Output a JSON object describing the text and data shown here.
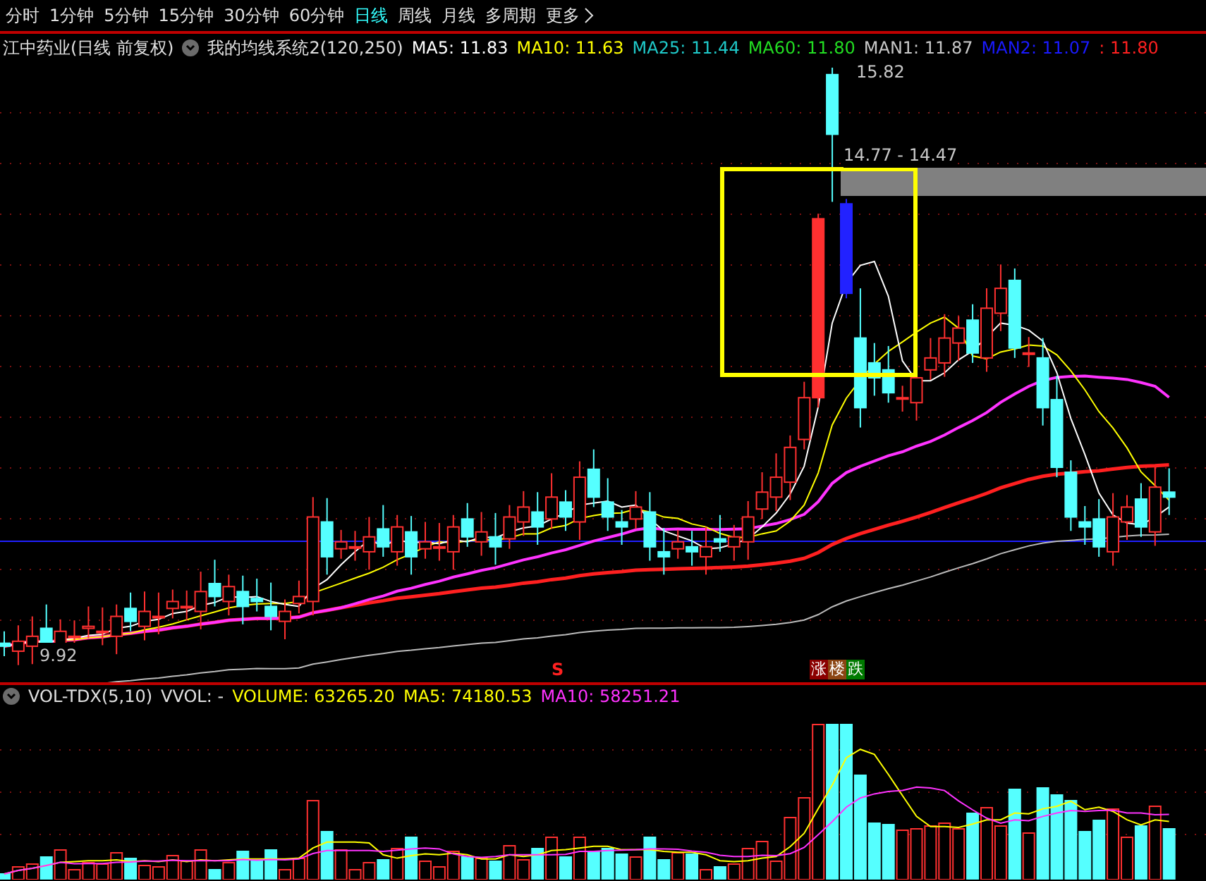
{
  "menu": [
    {
      "label": "分时",
      "selected": false
    },
    {
      "label": "1分钟",
      "selected": false
    },
    {
      "label": "5分钟",
      "selected": false
    },
    {
      "label": "15分钟",
      "selected": false
    },
    {
      "label": "30分钟",
      "selected": false
    },
    {
      "label": "60分钟",
      "selected": false
    },
    {
      "label": "日线",
      "selected": true
    },
    {
      "label": "周线",
      "selected": false
    },
    {
      "label": "月线",
      "selected": false
    },
    {
      "label": "多周期",
      "selected": false
    },
    {
      "label": "更多",
      "selected": false
    }
  ],
  "info_bar": {
    "title": "江中药业(日线 前复权)",
    "indicator": "我的均线系统2(120,250)",
    "values": [
      {
        "text": "MA5: 11.83",
        "color": "#ffffff"
      },
      {
        "text": "MA10: 11.63",
        "color": "#ffff00"
      },
      {
        "text": "MA25: 11.44",
        "color": "#1fc8c8"
      },
      {
        "text": "MA60: 11.80",
        "color": "#22dd22"
      },
      {
        "text": "MAN1: 11.87",
        "color": "#c8c8c8"
      },
      {
        "text": "MAN2: 11.07",
        "color": "#1a1aff"
      },
      {
        "text": ": 11.80",
        "color": "#ff2020"
      }
    ]
  },
  "price_chart": {
    "high_label": "15.82",
    "range_label": "14.77 - 14.47",
    "low_label": "9.92",
    "signal_mark": "S",
    "badge": [
      {
        "text": "涨",
        "color": "#8b0000"
      },
      {
        "text": "楼",
        "color": "#8b4513"
      },
      {
        "text": "跌",
        "color": "#007a00"
      }
    ]
  },
  "volume_panel": {
    "title": "VOL-TDX(5,10)",
    "values": [
      {
        "text": "VVOL: -",
        "color": "#e0e0e0"
      },
      {
        "text": "VOLUME: 63265.20",
        "color": "#ffff00"
      },
      {
        "text": "MA5: 74180.53",
        "color": "#ffff00"
      },
      {
        "text": "MA10: 58251.21",
        "color": "#ff33ff"
      }
    ]
  }
}
